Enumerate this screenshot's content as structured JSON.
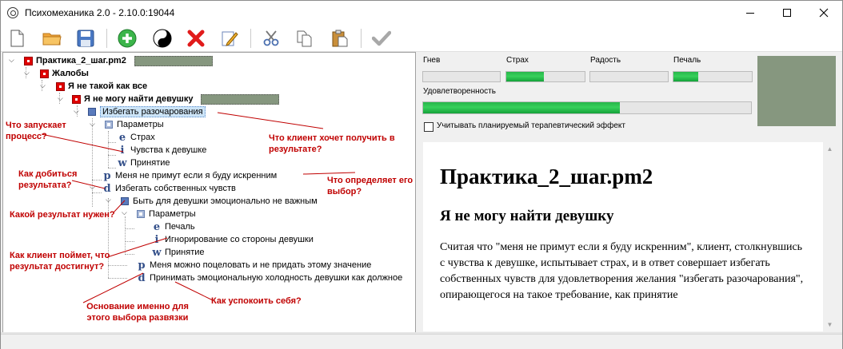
{
  "window": {
    "title": "Психомеханика 2.0 - 2.10.0:19044",
    "app_icon": "yin-yang-outline-icon"
  },
  "toolbar": {
    "buttons": [
      {
        "name": "new-file-button",
        "icon": "blank-document-icon"
      },
      {
        "name": "open-button",
        "icon": "folder-icon"
      },
      {
        "name": "save-button",
        "icon": "floppy-disk-icon"
      },
      {
        "name": "add-button",
        "icon": "green-plus-icon"
      },
      {
        "name": "balance-button",
        "icon": "yin-yang-icon"
      },
      {
        "name": "delete-button",
        "icon": "red-x-icon"
      },
      {
        "name": "edit-button",
        "icon": "pencil-icon"
      },
      {
        "name": "cut-button",
        "icon": "scissors-icon"
      },
      {
        "name": "copy-button",
        "icon": "copy-icon"
      },
      {
        "name": "paste-button",
        "icon": "paste-icon"
      },
      {
        "name": "apply-button",
        "icon": "checkmark-icon"
      }
    ]
  },
  "tree": {
    "nodes": [
      {
        "label": "Практика_2_шаг.pm2",
        "type": "red",
        "bold": true
      },
      {
        "label": "Жалобы",
        "type": "red",
        "bold": true
      },
      {
        "label": "Я не такой как все",
        "type": "red",
        "bold": true
      },
      {
        "label": "Я не могу найти девушку",
        "type": "red",
        "bold": true
      },
      {
        "label": "Избегать разочарования",
        "type": "blue",
        "selected": true
      },
      {
        "label": "Параметры",
        "type": "lightblue"
      },
      {
        "label": "Страх",
        "type": "e"
      },
      {
        "label": "Чувства к девушке",
        "type": "i"
      },
      {
        "label": "Принятие",
        "type": "w"
      },
      {
        "label": "Меня не примут если я буду искренним",
        "type": "p"
      },
      {
        "label": "Избегать собственных чувств",
        "type": "d"
      },
      {
        "label": "Быть для девушки эмоционально не важным",
        "type": "blue"
      },
      {
        "label": "Параметры",
        "type": "lightblue"
      },
      {
        "label": "Печаль",
        "type": "e"
      },
      {
        "label": "Игнорирование со стороны девушки",
        "type": "i"
      },
      {
        "label": "Принятие",
        "type": "w"
      },
      {
        "label": "Меня можно поцеловать и не придать этому значение",
        "type": "p"
      },
      {
        "label": "Принимать эмоциональную холодность девушки как должное",
        "type": "d"
      }
    ]
  },
  "annotations": [
    "Что запускает процесс?",
    "Что клиент хочет получить в результате?",
    "Как добиться результата?",
    "Что определяет его выбор?",
    "Какой результат нужен?",
    "Как клиент поймет, что результат достигнут?",
    "Основание именно для этого выбора развязки",
    "Как успокоить себя?"
  ],
  "emotions": {
    "labels": {
      "anger": "Гнев",
      "fear": "Страх",
      "joy": "Радость",
      "sadness": "Печаль",
      "satisfaction": "Удовлетворенность"
    },
    "levels": {
      "anger": 0,
      "fear": 0.48,
      "joy": 0,
      "sadness": 0.32,
      "satisfaction": 0.6
    },
    "fill_color": "#2ab84d",
    "swatch_color": "#86977f"
  },
  "therapy_checkbox": {
    "label": "Учитывать планируемый терапевтический  эффект",
    "checked": false
  },
  "document": {
    "title": "Практика_2_шаг.pm2",
    "subtitle": "Я не могу найти девушку",
    "body": "Считая что \"меня не примут если я буду искренним\", клиент, столкнувшись с чувства к девушке, испытывает страх, и в ответ совершает избегать собственных чувств для удовлетворения желания \"избегать разочарования\", опирающегося на такое требование, как принятие"
  }
}
